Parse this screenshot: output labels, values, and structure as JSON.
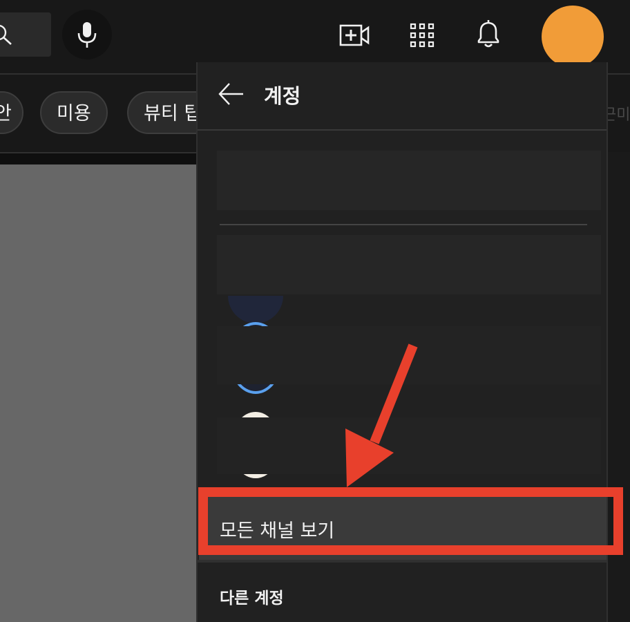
{
  "header": {
    "icons": [
      "search-icon",
      "mic-icon",
      "create-video-icon",
      "apps-grid-icon",
      "notifications-bell-icon"
    ],
    "avatar_color": "#f19c38"
  },
  "chips": {
    "partial_left": "안",
    "items": [
      "미용",
      "뷰티 팁"
    ],
    "partial_right": "근미"
  },
  "account_panel": {
    "back_icon": "arrow-left-icon",
    "title": "계정",
    "view_all_channels": "모든 채널 보기",
    "other_accounts": "다른 계정"
  },
  "annotation": {
    "highlight_color": "#e8402c"
  }
}
